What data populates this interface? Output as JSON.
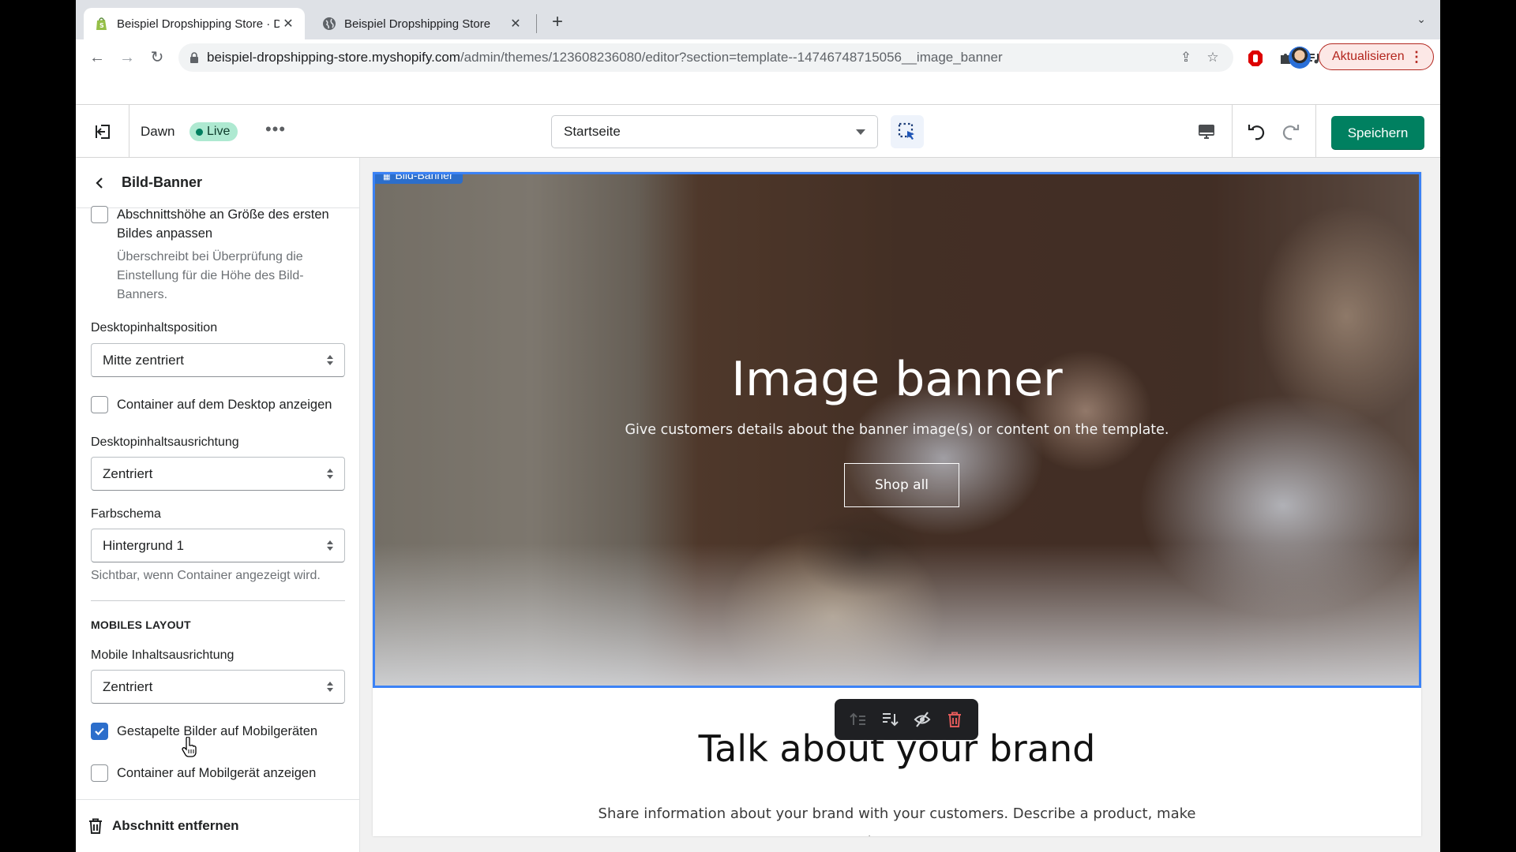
{
  "browser": {
    "tabs": [
      {
        "title": "Beispiel Dropshipping Store · D",
        "icon": "shopify-icon",
        "active": true
      },
      {
        "title": "Beispiel Dropshipping Store",
        "icon": "globe-icon",
        "active": false
      }
    ],
    "new_tab_label": "+",
    "url_host": "beispiel-dropshipping-store.myshopify.com",
    "url_path": "/admin/themes/123608236080/editor?section=template--14746748715056__image_banner",
    "update_button": "Aktualisieren"
  },
  "editor": {
    "theme_name": "Dawn",
    "status_badge": "Live",
    "more_label": "•••",
    "page_select": "Startseite",
    "save_button": "Speichern",
    "accent": "#008060"
  },
  "panel": {
    "title": "Bild-Banner",
    "adapt_height": {
      "label": "Abschnittshöhe an Größe des ersten Bildes anpassen",
      "checked": false,
      "help": "Überschreibt bei Überprüfung die Einstellung für die Höhe des Bild-Banners."
    },
    "desktop_position": {
      "label": "Desktopinhaltsposition",
      "value": "Mitte zentriert"
    },
    "desktop_container": {
      "label": "Container auf dem Desktop anzeigen",
      "checked": false
    },
    "desktop_alignment": {
      "label": "Desktopinhaltsausrichtung",
      "value": "Zentriert"
    },
    "color_scheme": {
      "label": "Farbschema",
      "value": "Hintergrund 1",
      "help": "Sichtbar, wenn Container angezeigt wird."
    },
    "mobile_section": "MOBILES LAYOUT",
    "mobile_alignment": {
      "label": "Mobile Inhaltsausrichtung",
      "value": "Zentriert"
    },
    "stacked_images": {
      "label": "Gestapelte Bilder auf Mobilgeräten",
      "checked": true
    },
    "mobile_container": {
      "label": "Container auf Mobilgerät anzeigen",
      "checked": false
    },
    "remove_section": "Abschnitt entfernen"
  },
  "preview": {
    "section_tag": "Bild-Banner",
    "banner_title": "Image banner",
    "banner_subtitle": "Give customers details about the banner image(s) or content on the template.",
    "banner_button": "Shop all",
    "brand_title": "Talk about your brand",
    "brand_text": "Share information about your brand with your customers. Describe a product, make announcements, or welcome customers to your store."
  }
}
